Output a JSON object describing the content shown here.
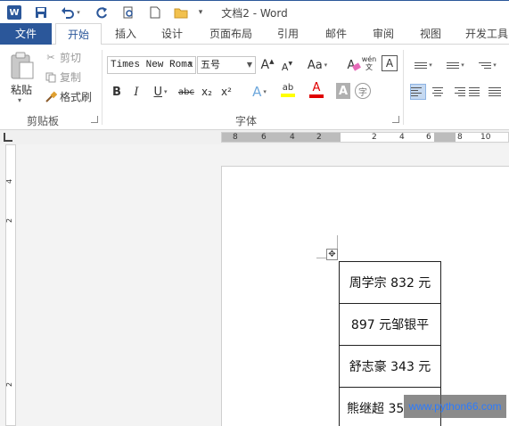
{
  "window": {
    "title": "文档2 - Word"
  },
  "tabs": [
    {
      "label": "文件"
    },
    {
      "label": "开始"
    },
    {
      "label": "插入"
    },
    {
      "label": "设计"
    },
    {
      "label": "页面布局"
    },
    {
      "label": "引用"
    },
    {
      "label": "邮件"
    },
    {
      "label": "审阅"
    },
    {
      "label": "视图"
    },
    {
      "label": "开发工具"
    }
  ],
  "clipboard": {
    "paste": "粘贴",
    "cut": "剪切",
    "copy": "复制",
    "format_painter": "格式刷",
    "group_label": "剪贴板"
  },
  "font": {
    "font_name": "Times New Roma",
    "font_size": "五号",
    "group_label": "字体",
    "grow": "A",
    "shrink": "A",
    "case": "Aa",
    "clear": "A",
    "phonetic": "wén",
    "border_char": "A",
    "bold": "B",
    "italic": "I",
    "underline": "U",
    "strike": "abc",
    "subscript": "x₂",
    "superscript": "x²",
    "effects": "A",
    "highlight": "ab",
    "color": "A",
    "shading": "A",
    "enclose": "字"
  },
  "ruler": {
    "labels": [
      "8",
      "6",
      "4",
      "2",
      "2",
      "4",
      "6",
      "8",
      "10"
    ],
    "vlabels": [
      "4",
      "2",
      "2"
    ]
  },
  "table": {
    "rows": [
      "周学宗 832 元",
      "897 元邹银平",
      "舒志豪 343 元",
      "熊继超 35"
    ]
  },
  "table_handle": "✥",
  "watermark": "www.python66.com",
  "colors": {
    "accent": "#2b579a",
    "highlight_bar": "#ffff00",
    "font_color_bar": "#e00000"
  }
}
